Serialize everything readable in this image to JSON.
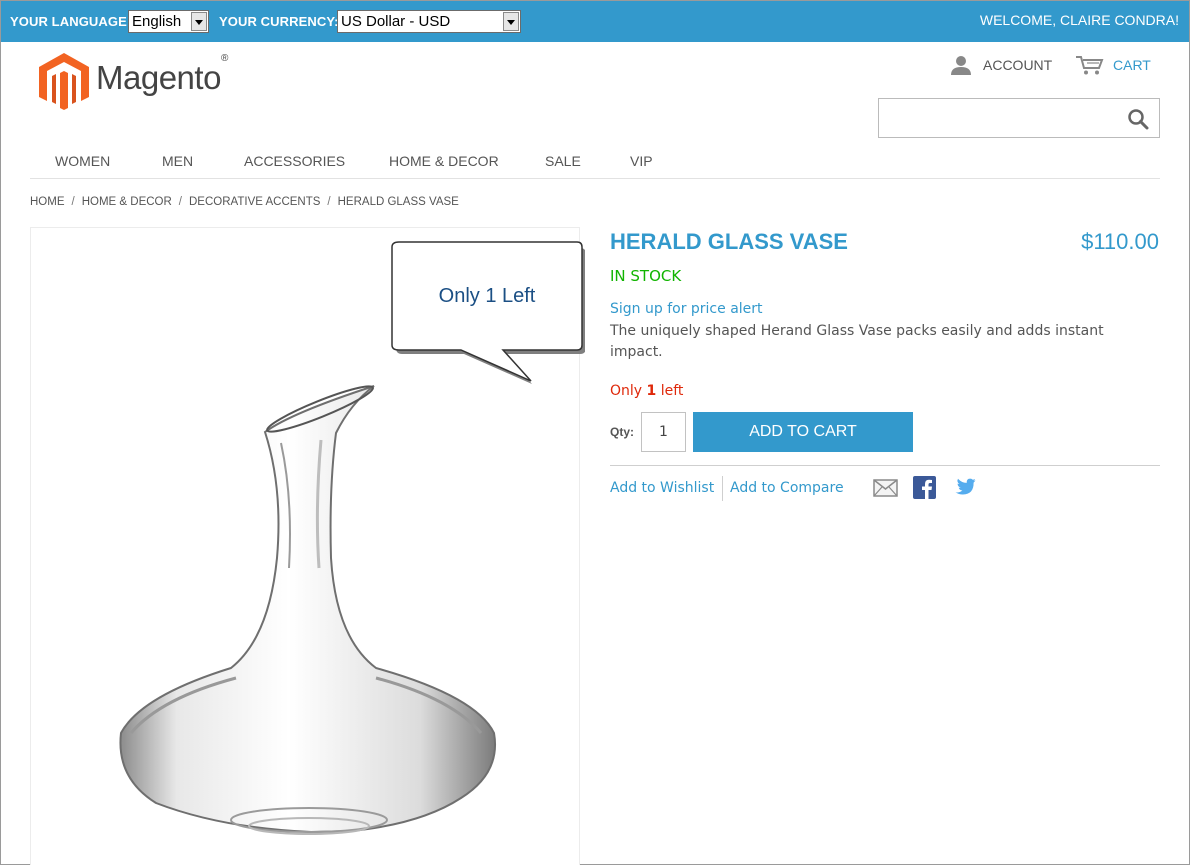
{
  "topbar": {
    "language_label": "YOUR LANGUAGE:",
    "language_value": "English",
    "currency_label": "YOUR CURRENCY:",
    "currency_value": "US Dollar - USD",
    "welcome": "WELCOME, CLAIRE CONDRA!",
    "background": "#3399cc"
  },
  "header": {
    "logo_text": "Magento",
    "logo_mark": "®",
    "account_label": "ACCOUNT",
    "cart_label": "CART",
    "search_placeholder": ""
  },
  "nav": {
    "items": [
      "WOMEN",
      "MEN",
      "ACCESSORIES",
      "HOME & DECOR",
      "SALE",
      "VIP"
    ]
  },
  "breadcrumb": {
    "items": [
      "HOME",
      "HOME & DECOR",
      "DECORATIVE ACCENTS",
      "HERALD GLASS VASE"
    ],
    "separator": "/"
  },
  "callout": {
    "text": "Only 1 Left"
  },
  "product": {
    "name": "HERALD GLASS VASE",
    "price": "$110.00",
    "stock": "IN STOCK",
    "price_alert_link": "Sign up for price alert",
    "description": "The uniquely shaped Herand Glass Vase packs easily and adds instant impact.",
    "only_prefix": "Only",
    "only_count": "1",
    "only_suffix": "left",
    "qty_label": "Qty:",
    "qty_value": "1",
    "add_to_cart_label": "ADD TO CART",
    "wishlist_link": "Add to Wishlist",
    "compare_link": "Add to Compare",
    "share_icons": [
      "email-icon",
      "facebook-icon",
      "twitter-icon"
    ]
  },
  "colors": {
    "accent": "#3399cc",
    "in_stock": "#11b400",
    "low_stock": "#df280a",
    "logo_orange": "#f26322"
  }
}
